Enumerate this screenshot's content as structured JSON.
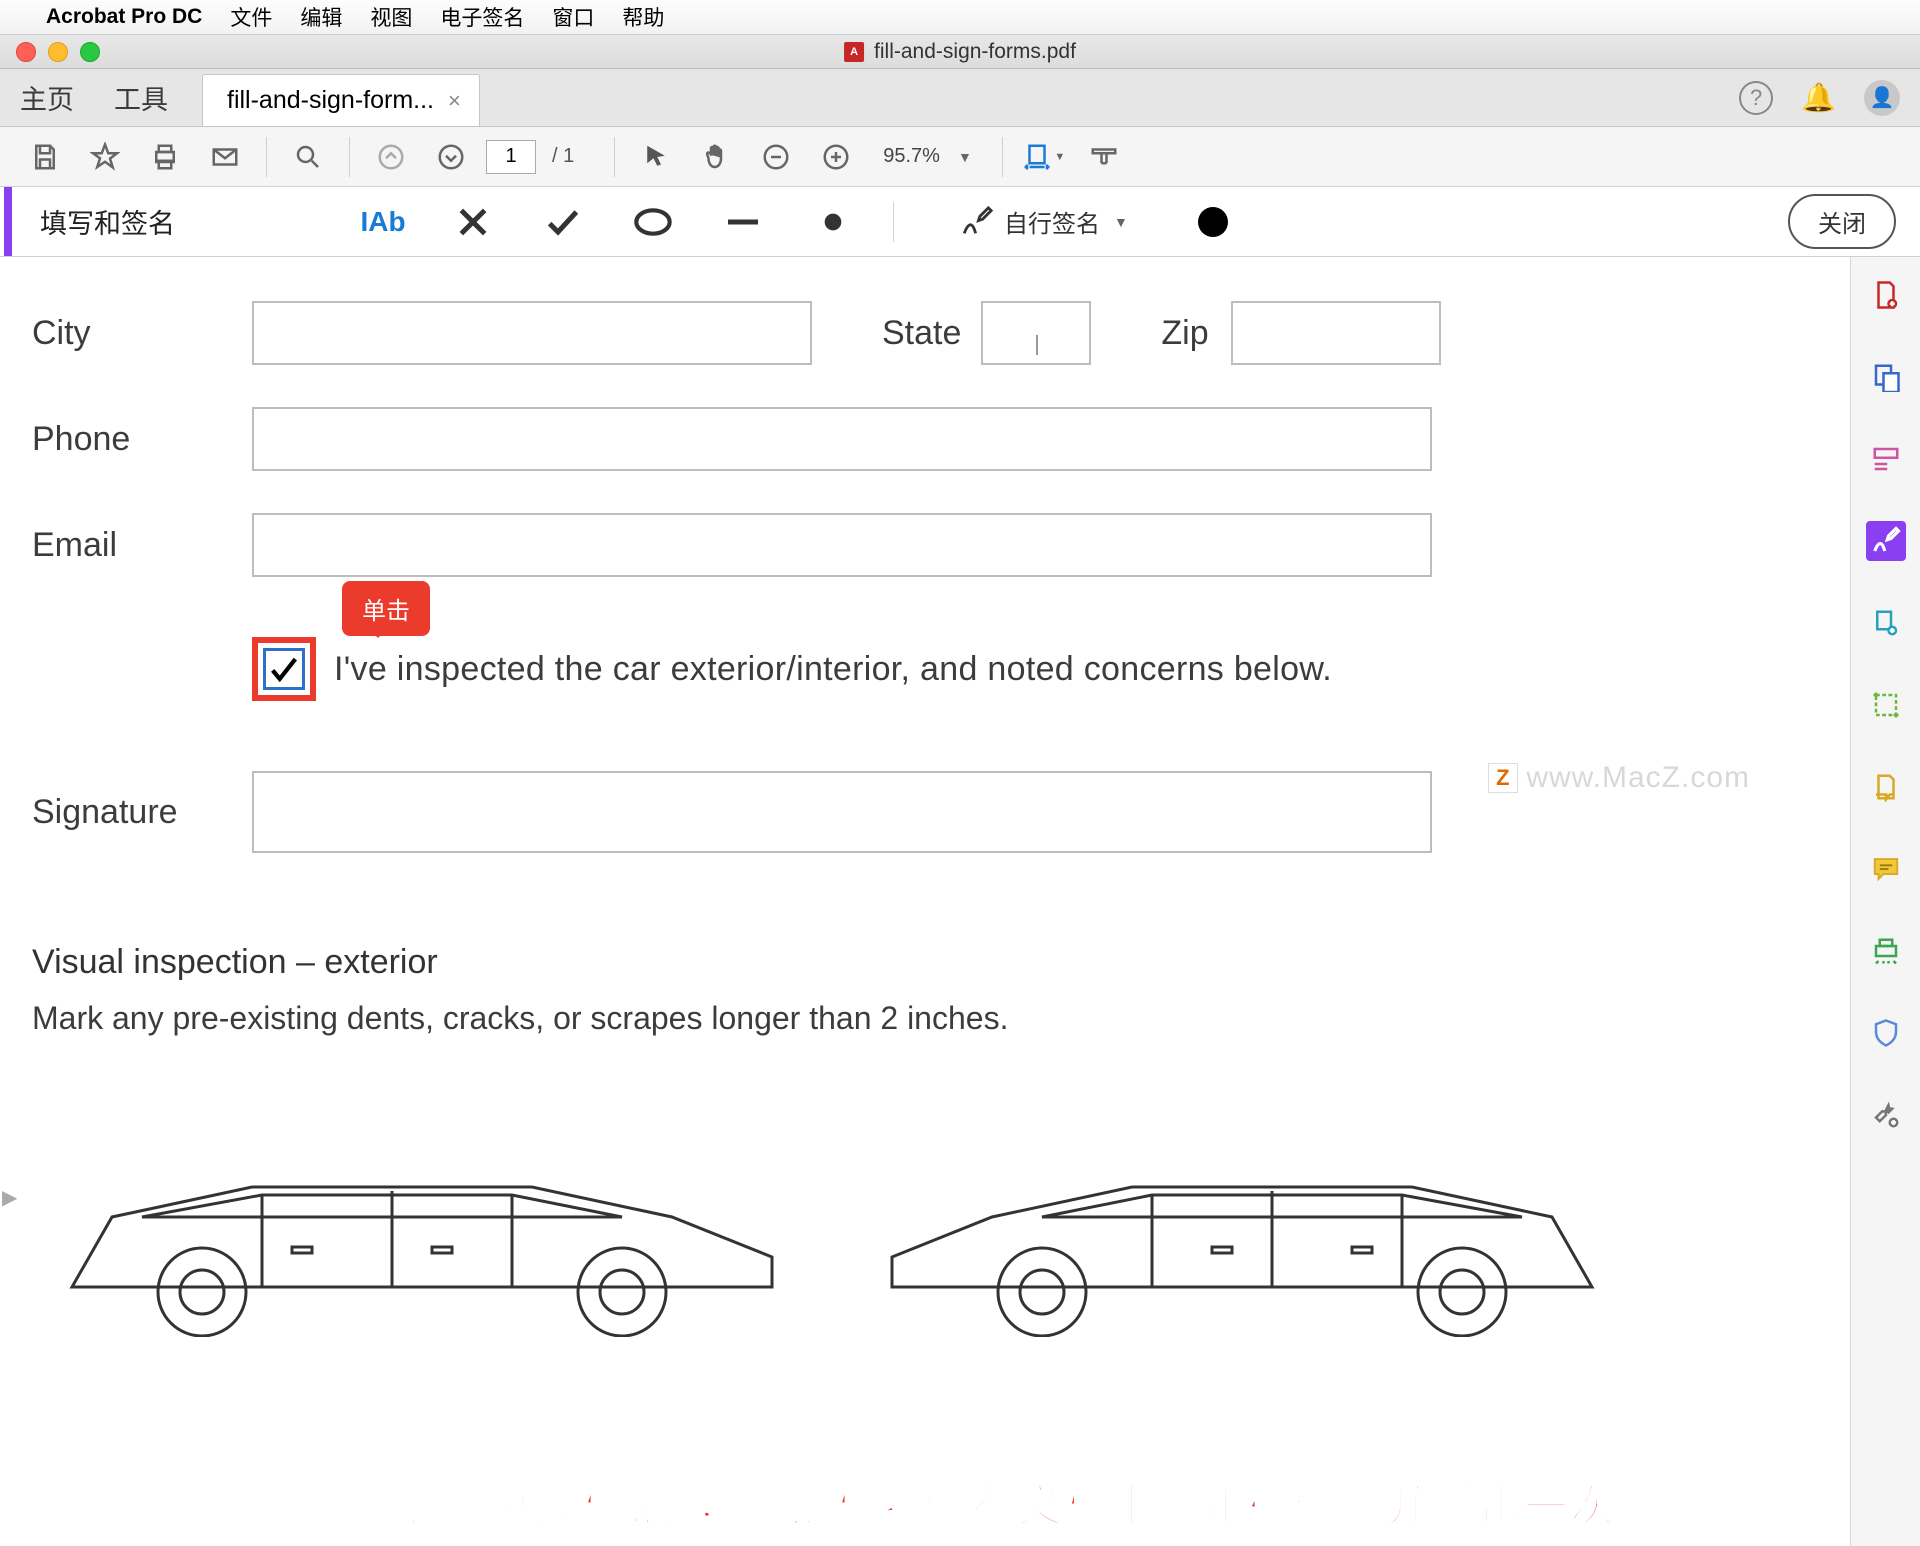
{
  "menubar": {
    "app": "Acrobat Pro DC",
    "items": [
      "文件",
      "编辑",
      "视图",
      "电子签名",
      "窗口",
      "帮助"
    ]
  },
  "window": {
    "title": "fill-and-sign-forms.pdf"
  },
  "tabs": {
    "home": "主页",
    "tools": "工具",
    "file": "fill-and-sign-form...",
    "close_x": "×"
  },
  "toolbar": {
    "page_current": "1",
    "page_total": "/ 1",
    "zoom": "95.7%"
  },
  "fillsign": {
    "title": "填写和签名",
    "ab": "IAb",
    "self_sign": "自行签名",
    "close": "关闭"
  },
  "form": {
    "city": "City",
    "state": "State",
    "zip": "Zip",
    "phone": "Phone",
    "email": "Email",
    "inspected": "I've inspected the car exterior/interior, and noted concerns below.",
    "signature": "Signature",
    "section_h": "Visual inspection – exterior",
    "section_p": "Mark any pre-existing dents, cracks, or scrapes longer than 2 inches."
  },
  "tooltip": "单击",
  "watermark": "www.MacZ.com",
  "caption": "要添加「复选标记」，将鼠标悬停在文档中的正确位置并单击一次"
}
